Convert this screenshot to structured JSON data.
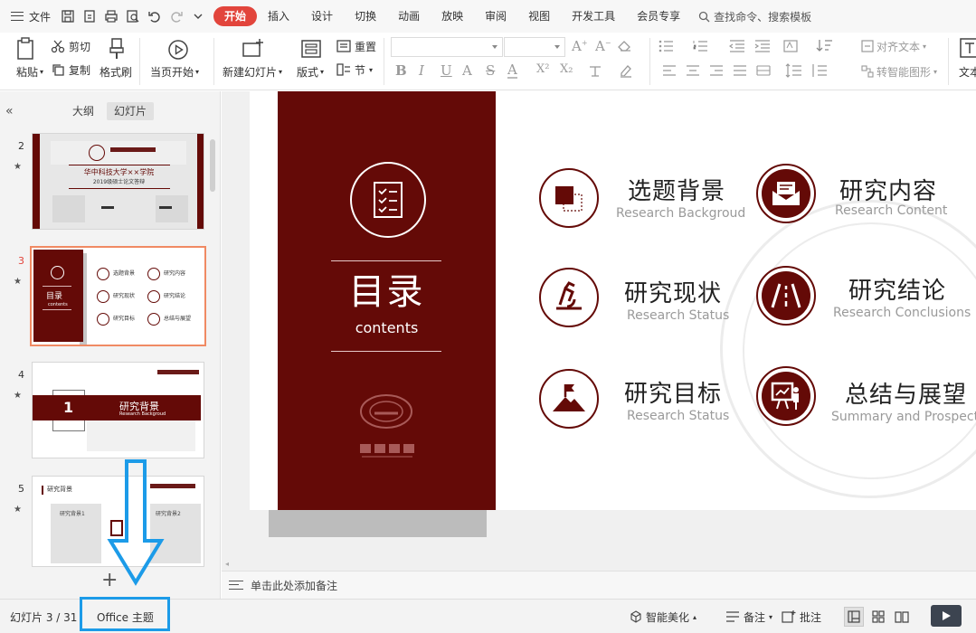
{
  "menubar": {
    "file_label": "文件",
    "tabs": [
      "开始",
      "插入",
      "设计",
      "切换",
      "动画",
      "放映",
      "审阅",
      "视图",
      "开发工具",
      "会员专享"
    ],
    "active_tab": "开始",
    "search_label": "查找命令、搜索模板"
  },
  "ribbon": {
    "paste": "粘贴",
    "cut": "剪切",
    "copy": "复制",
    "format_painter": "格式刷",
    "play_from_current": "当页开始",
    "new_slide": "新建幻灯片",
    "layout": "版式",
    "reset": "重置",
    "section": "节",
    "align_text": "对齐文本",
    "smartart": "转智能图形",
    "text_cut": "文本",
    "format": [
      "B",
      "I",
      "U",
      "A",
      "S",
      "A",
      "X²",
      "X₂"
    ]
  },
  "left_panel": {
    "tab_outline": "大纲",
    "tab_slides": "幻灯片",
    "slides": [
      {
        "num": "2"
      },
      {
        "num": "3"
      },
      {
        "num": "4"
      },
      {
        "num": "5"
      }
    ],
    "thumb2": {
      "title": "华中科技大学××学院",
      "subtitle": "2019级硕士论文答辩"
    },
    "thumb4": {
      "num": "1",
      "title": "研究背景",
      "sub": "Research Backgroud"
    },
    "thumb5": {
      "title": "研究背景",
      "box1": "研究背景1",
      "box2": "研究背景2"
    }
  },
  "slide": {
    "title_cn": "目录",
    "title_en": "contents",
    "items": [
      {
        "cn": "选题背景",
        "en": "Research Backgroud"
      },
      {
        "cn": "研究内容",
        "en": "Research Content"
      },
      {
        "cn": "研究现状",
        "en": "Research Status"
      },
      {
        "cn": "研究结论",
        "en": "Research Conclusions"
      },
      {
        "cn": "研究目标",
        "en": "Research Status"
      },
      {
        "cn": "总结与展望",
        "en": "Summary and Prospects"
      }
    ]
  },
  "notes": {
    "placeholder": "单击此处添加备注"
  },
  "status": {
    "slide_counter": "幻灯片 3 / 31",
    "theme": "Office 主题",
    "smart_beautify": "智能美化",
    "notes": "备注",
    "comments": "批注"
  },
  "colors": {
    "accent": "#e2453c",
    "maroon": "#640a07",
    "highlight": "#1c9be8",
    "selected_thumb": "#f08a63"
  }
}
